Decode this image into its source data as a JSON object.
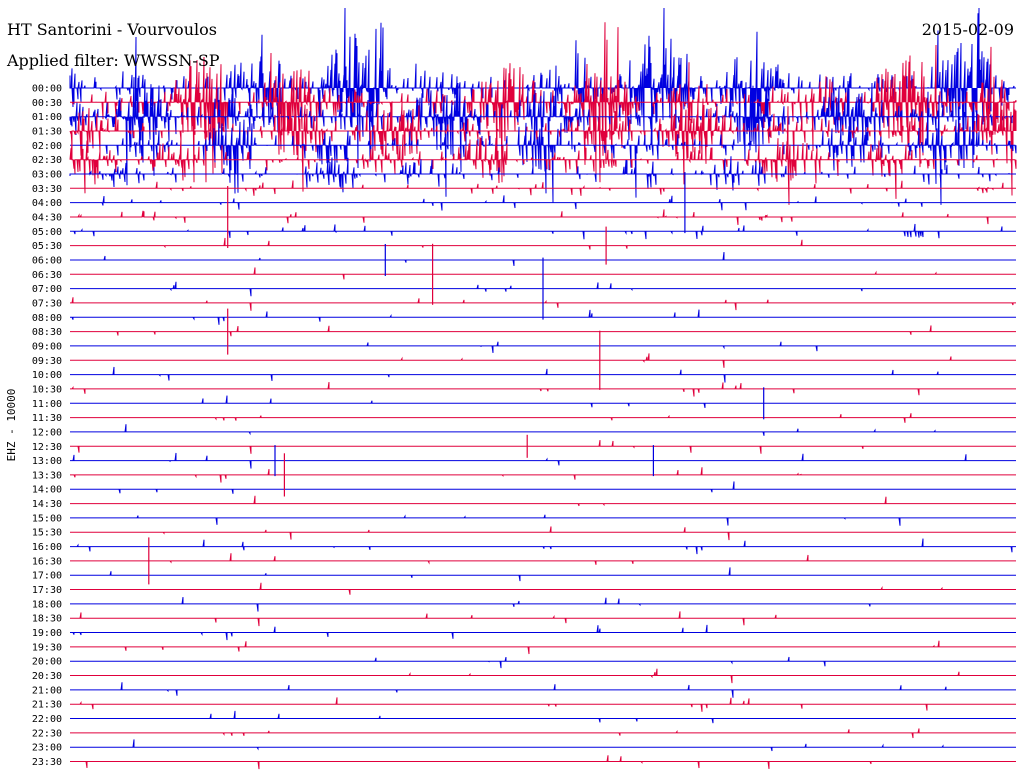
{
  "header": {
    "station_title": "HT Santorini - Vourvoulos",
    "filter_label": "Applied filter: WWSSN-SP",
    "date": "2015-02-09"
  },
  "colors": {
    "odd_trace": "#0000e0",
    "even_trace": "#e0003c",
    "background": "#ffffff",
    "text": "#000000"
  },
  "chart_data": {
    "type": "line",
    "title": "HT Santorini - Vourvoulos",
    "subtitle": "Applied filter: WWSSN-SP",
    "ylabel": "EHZ - 10000",
    "xlabel": "",
    "grid": false,
    "ticks": [
      "00:00",
      "00:30",
      "01:00",
      "01:30",
      "02:00",
      "02:30",
      "03:00",
      "03:30",
      "04:00",
      "04:30",
      "05:00",
      "05:30",
      "06:00",
      "06:30",
      "07:00",
      "07:30",
      "08:00",
      "08:30",
      "09:00",
      "09:30",
      "10:00",
      "10:30",
      "11:00",
      "11:30",
      "12:00",
      "12:30",
      "13:00",
      "13:30",
      "14:00",
      "14:30",
      "15:00",
      "15:30",
      "16:00",
      "16:30",
      "17:00",
      "17:30",
      "18:00",
      "18:30",
      "19:00",
      "19:30",
      "20:00",
      "20:30",
      "21:00",
      "21:30",
      "22:00",
      "22:30",
      "23:00",
      "23:30"
    ],
    "trace_minutes_per_line": 30,
    "notable_events": [
      {
        "line": 17,
        "minute": 5.0
      },
      {
        "line": 19,
        "minute": 16.8
      },
      {
        "line": 22,
        "minute": 22.0
      },
      {
        "line": 25,
        "minute": 14.5
      },
      {
        "line": 26,
        "minute": 6.5
      },
      {
        "line": 26,
        "minute": 18.5
      },
      {
        "line": 27,
        "minute": 6.8
      },
      {
        "line": 33,
        "minute": 2.5
      },
      {
        "line": 12,
        "minute": 10.0
      },
      {
        "line": 13,
        "minute": 11.5
      },
      {
        "line": 14,
        "minute": 15.0
      },
      {
        "line": 11,
        "minute": 17.0
      },
      {
        "line": 9,
        "minute": 5.0
      },
      {
        "line": 8,
        "minute": 19.5
      }
    ]
  }
}
